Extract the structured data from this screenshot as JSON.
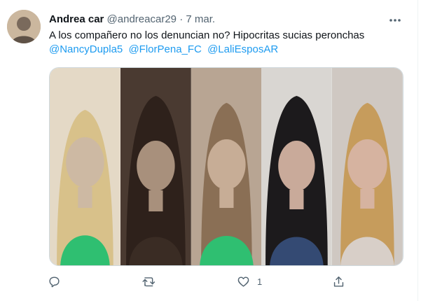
{
  "tweet": {
    "display_name": "Andrea car",
    "handle": "@andreacar29",
    "separator": "·",
    "date": "7 mar.",
    "text": "A los compañero no los denuncian no? Hipocritas sucias peronchas",
    "mentions": [
      "@NancyDupla5",
      "@FlorPena_FC",
      "@LaliEsposAR"
    ]
  },
  "actions": {
    "reply_count": "",
    "retweet_count": "",
    "like_count": "1"
  },
  "colors": {
    "text": "#0f1419",
    "meta": "#536471",
    "link": "#1d9bf0",
    "border": "#cfd9de",
    "scarf": "#2fbf71"
  },
  "icons": [
    "more-icon",
    "reply-icon",
    "retweet-icon",
    "like-icon",
    "share-icon"
  ]
}
